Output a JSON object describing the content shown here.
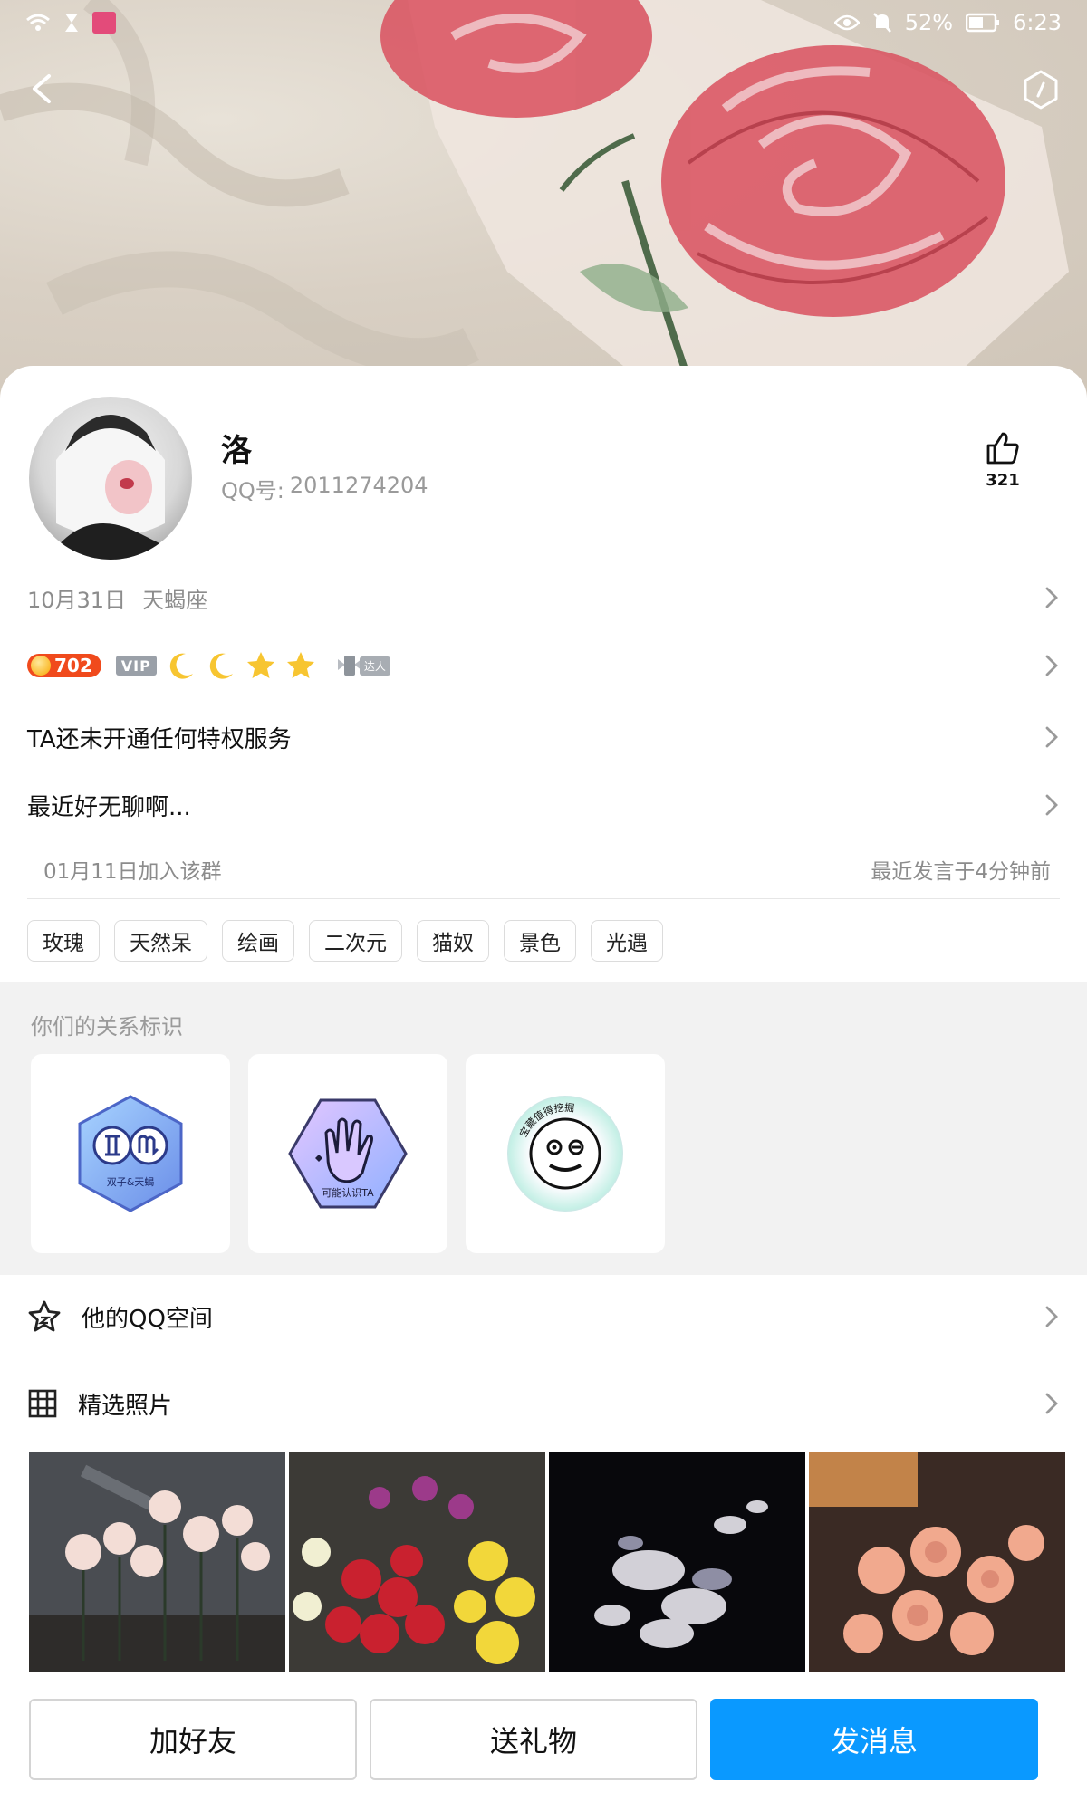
{
  "status_bar": {
    "battery": "52%",
    "time": "6:23"
  },
  "profile": {
    "name": "洛",
    "qq_label": "QQ号:",
    "qq_number": "2011274204",
    "likes": "321",
    "birthday": "10月31日",
    "zodiac": "天蝎座",
    "level": "702",
    "vip_label": "VIP",
    "master_label": "达人",
    "privilege_text": "TA还未开通任何特权服务",
    "signature": "最近好无聊啊...",
    "join_group": "01月11日加入该群",
    "last_speak": "最近发言于4分钟前"
  },
  "tags": [
    "玫瑰",
    "天然呆",
    "绘画",
    "二次元",
    "猫奴",
    "景色",
    "光遇"
  ],
  "relation": {
    "title": "你们的关系标识",
    "badges": [
      {
        "label": "双子&天蝎",
        "icon": "gemini-scorpio-badge-icon"
      },
      {
        "label": "可能认识TA",
        "icon": "wave-hand-badge-icon"
      },
      {
        "label": "宝藏值得挖掘",
        "icon": "smiley-badge-icon"
      }
    ]
  },
  "list": {
    "qzone_label": "他的QQ空间",
    "photos_label": "精选照片"
  },
  "actions": {
    "add_friend": "加好友",
    "send_gift": "送礼物",
    "send_message": "发消息"
  },
  "colors": {
    "primary_button": "#0a99ff",
    "level_badge": "#f04a1c",
    "cover_rose": "#d9505e"
  }
}
